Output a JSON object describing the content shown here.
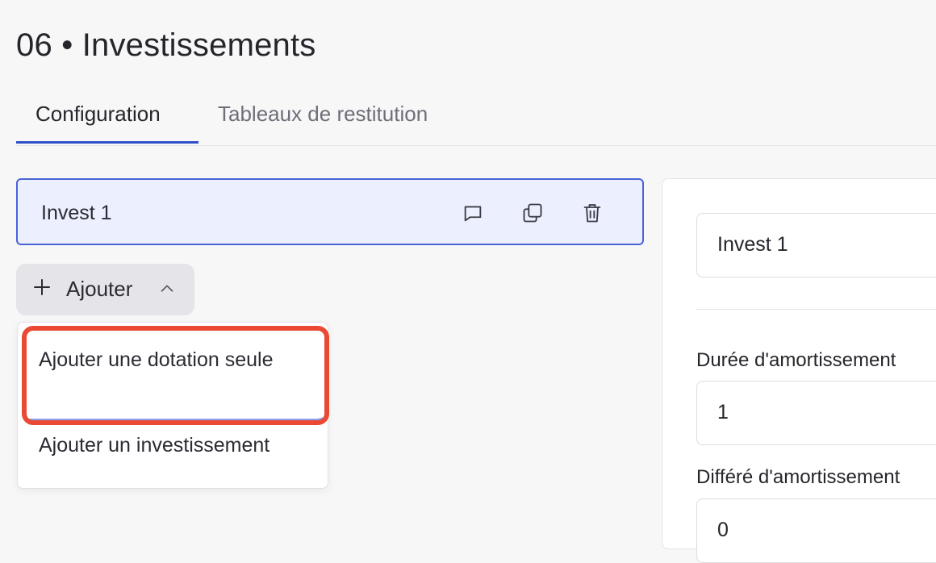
{
  "page": {
    "title": "06 • Investissements"
  },
  "tabs": [
    {
      "label": "Configuration",
      "active": true
    },
    {
      "label": "Tableaux de restitution",
      "active": false
    }
  ],
  "investments": [
    {
      "name": "Invest 1",
      "icons": [
        "comment-icon",
        "duplicate-icon",
        "trash-icon"
      ]
    }
  ],
  "add_button": {
    "label": "Ajouter",
    "icon": "plus-icon",
    "chevron": "chevron-up-icon"
  },
  "add_menu": {
    "items": [
      {
        "label": "Ajouter une dotation seule",
        "highlighted": true
      },
      {
        "label": "Ajouter un investissement",
        "highlighted": false
      }
    ]
  },
  "detail": {
    "name_value": "Invest 1",
    "fields": [
      {
        "label": "Durée d'amortissement",
        "value": "1"
      },
      {
        "label": "Différé d'amortissement",
        "value": "0"
      }
    ]
  },
  "colors": {
    "accent": "#2f4fc9",
    "selected_card_bg": "#eceffd",
    "selected_card_border": "#4a63d6",
    "annotation_red": "#ea4a33"
  }
}
